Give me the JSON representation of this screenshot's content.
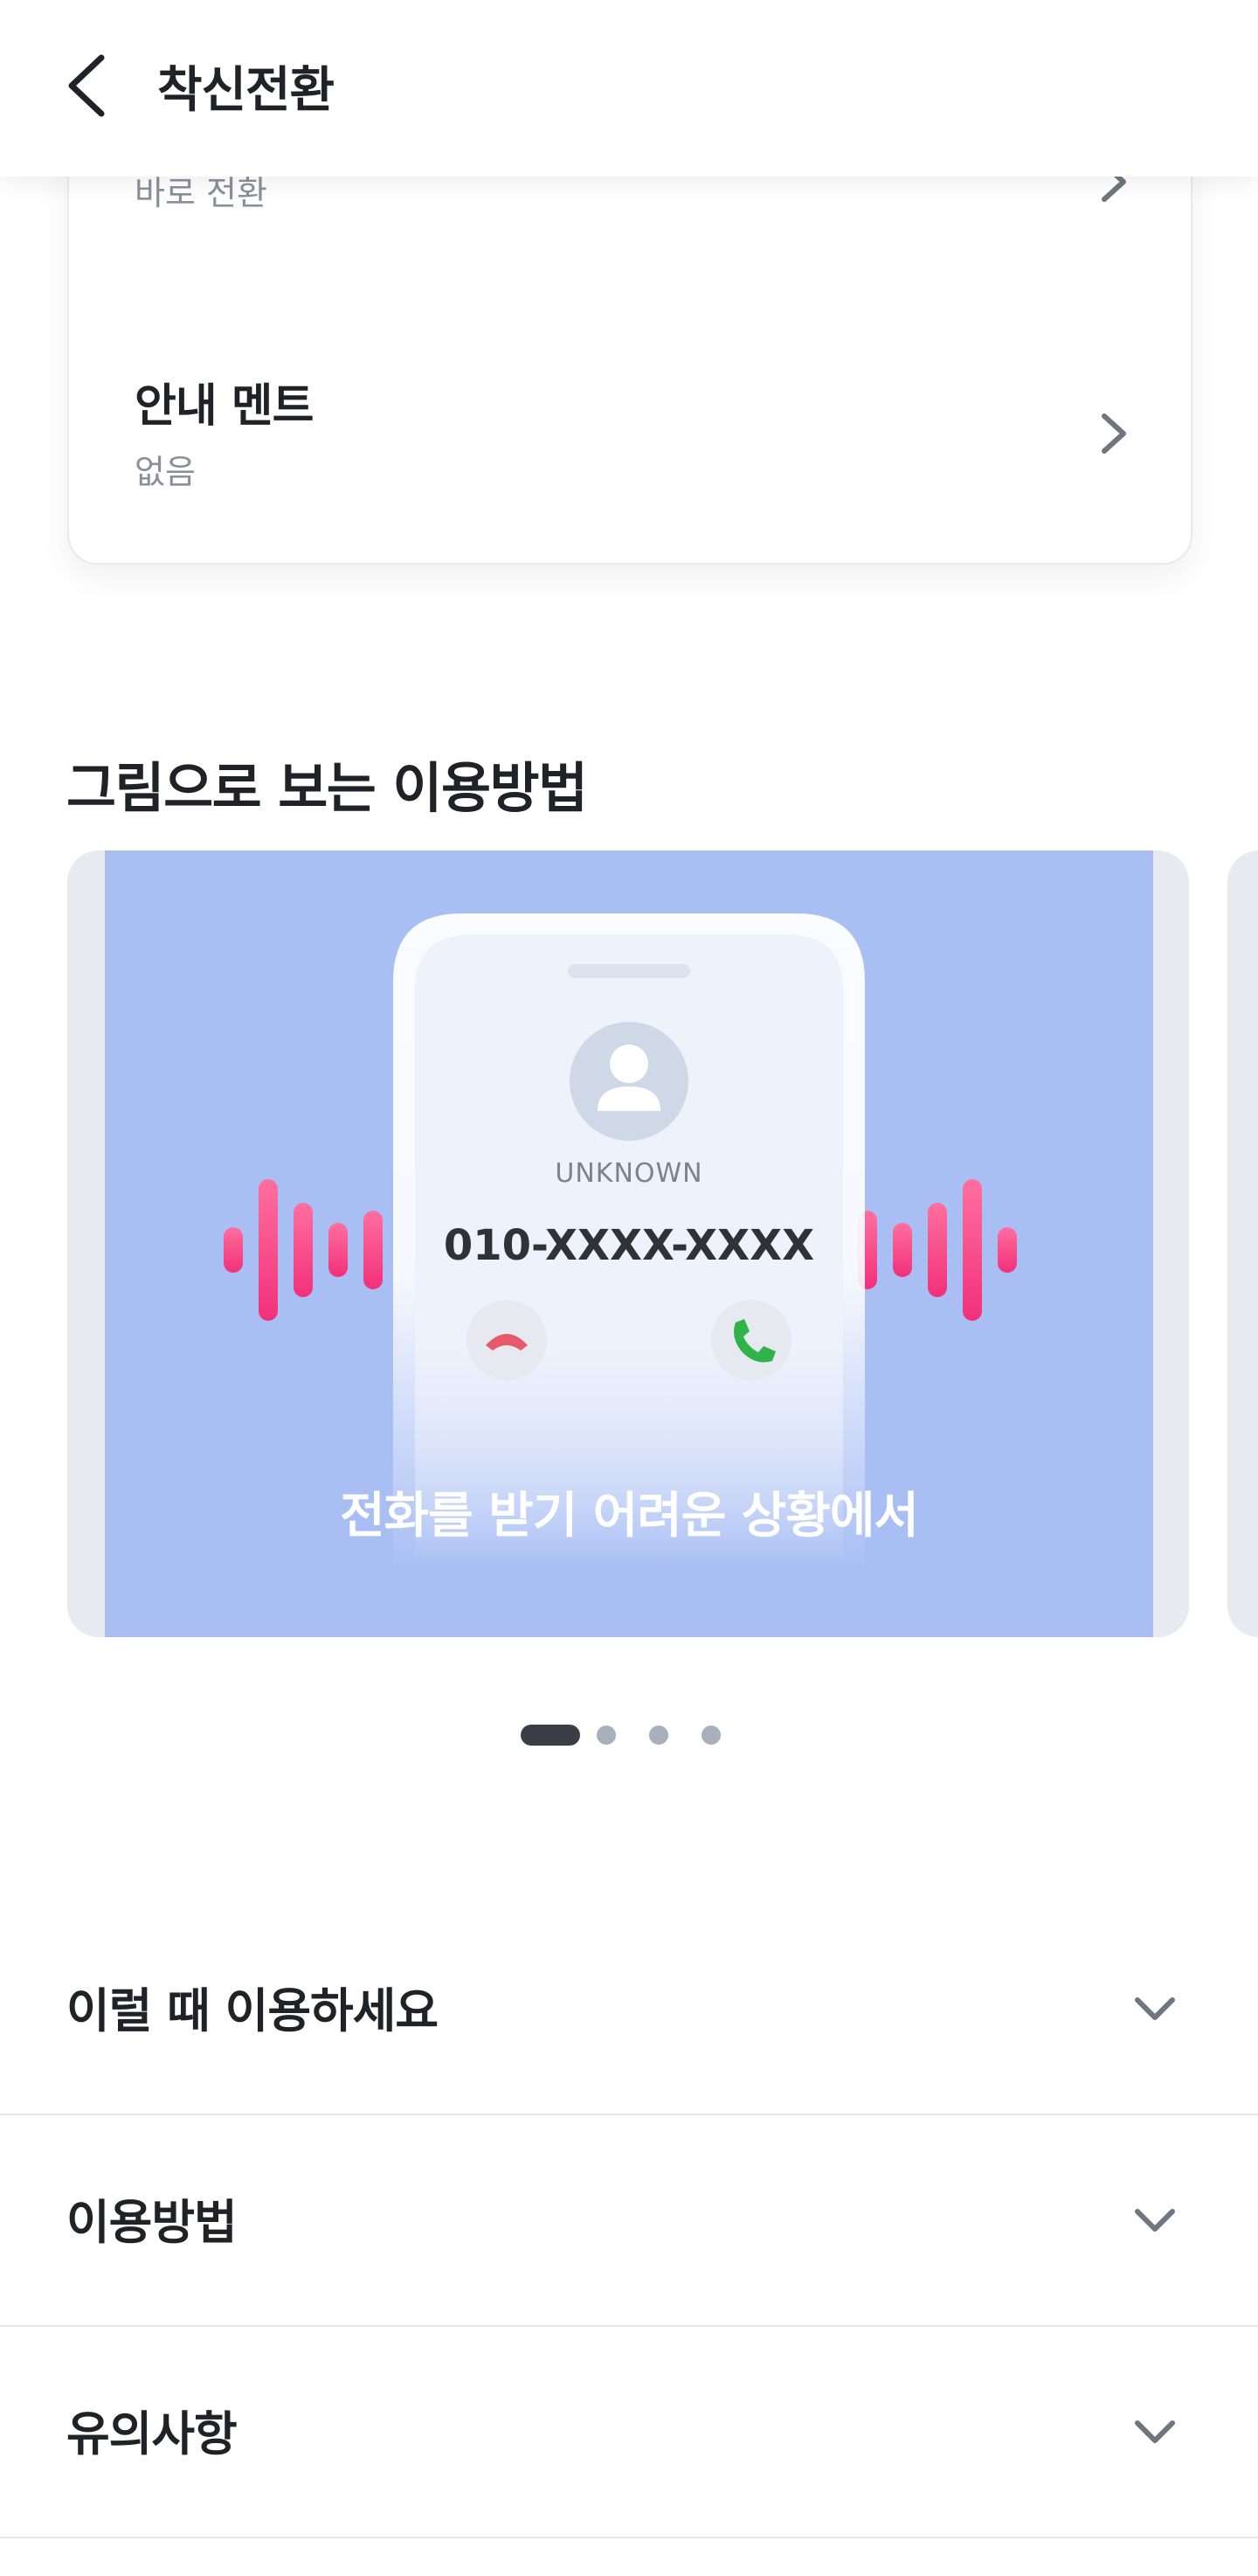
{
  "appbar": {
    "title": "착신전환",
    "back_icon": "chevron-left-icon"
  },
  "settings": [
    {
      "label": "",
      "value": "바로 전환"
    },
    {
      "label": "안내 멘트",
      "value": "없음"
    }
  ],
  "guide": {
    "title": "그림으로 보는 이용방법",
    "slides": [
      {
        "contact_label": "UNKNOWN",
        "phone_number": "010-XXXX-XXXX",
        "caption": "전화를 받기 어려운 상황에서"
      }
    ],
    "page_count": 4,
    "active_page": 1
  },
  "accordions": [
    {
      "label": "이럴 때 이용하세요"
    },
    {
      "label": "이용방법"
    },
    {
      "label": "유의사항"
    }
  ],
  "colors": {
    "slide_bg": "#a9bff4",
    "wave": "#f0457f",
    "decline": "#e5596a",
    "accept": "#2fb34a",
    "dot_active": "#3a3e45",
    "dot_inactive": "#a8b0bb"
  }
}
